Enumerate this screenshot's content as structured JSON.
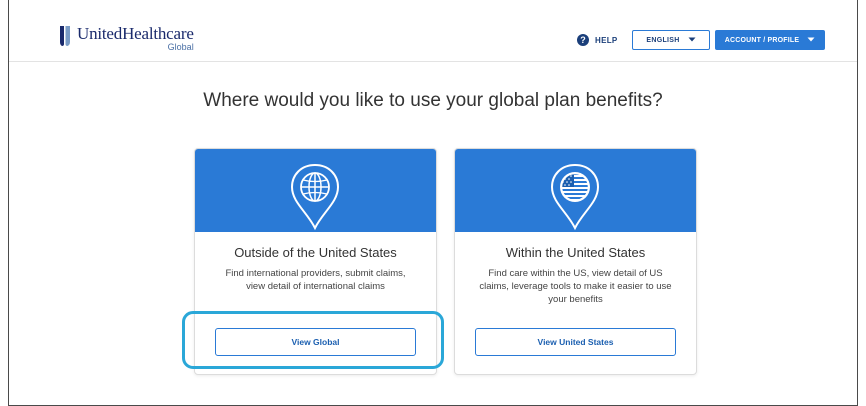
{
  "header": {
    "brand_name": "UnitedHealthcare",
    "brand_sub": "Global",
    "help_label": "HELP",
    "language_label": "ENGLISH",
    "account_label": "ACCOUNT / PROFILE"
  },
  "main": {
    "headline": "Where would you like to use your global plan benefits?",
    "cards": [
      {
        "title": "Outside of the United States",
        "description": "Find international providers, submit claims, view detail of international claims",
        "button_label": "View Global",
        "icon": "globe-pin-icon"
      },
      {
        "title": "Within the United States",
        "description": "Find care within the US, view detail of US claims, leverage tools to make it easier to use your benefits",
        "button_label": "View United States",
        "icon": "us-flag-pin-icon"
      }
    ]
  },
  "colors": {
    "accent": "#2a7ad6",
    "navy": "#1b3f7a",
    "highlight": "#2aa7d8"
  }
}
